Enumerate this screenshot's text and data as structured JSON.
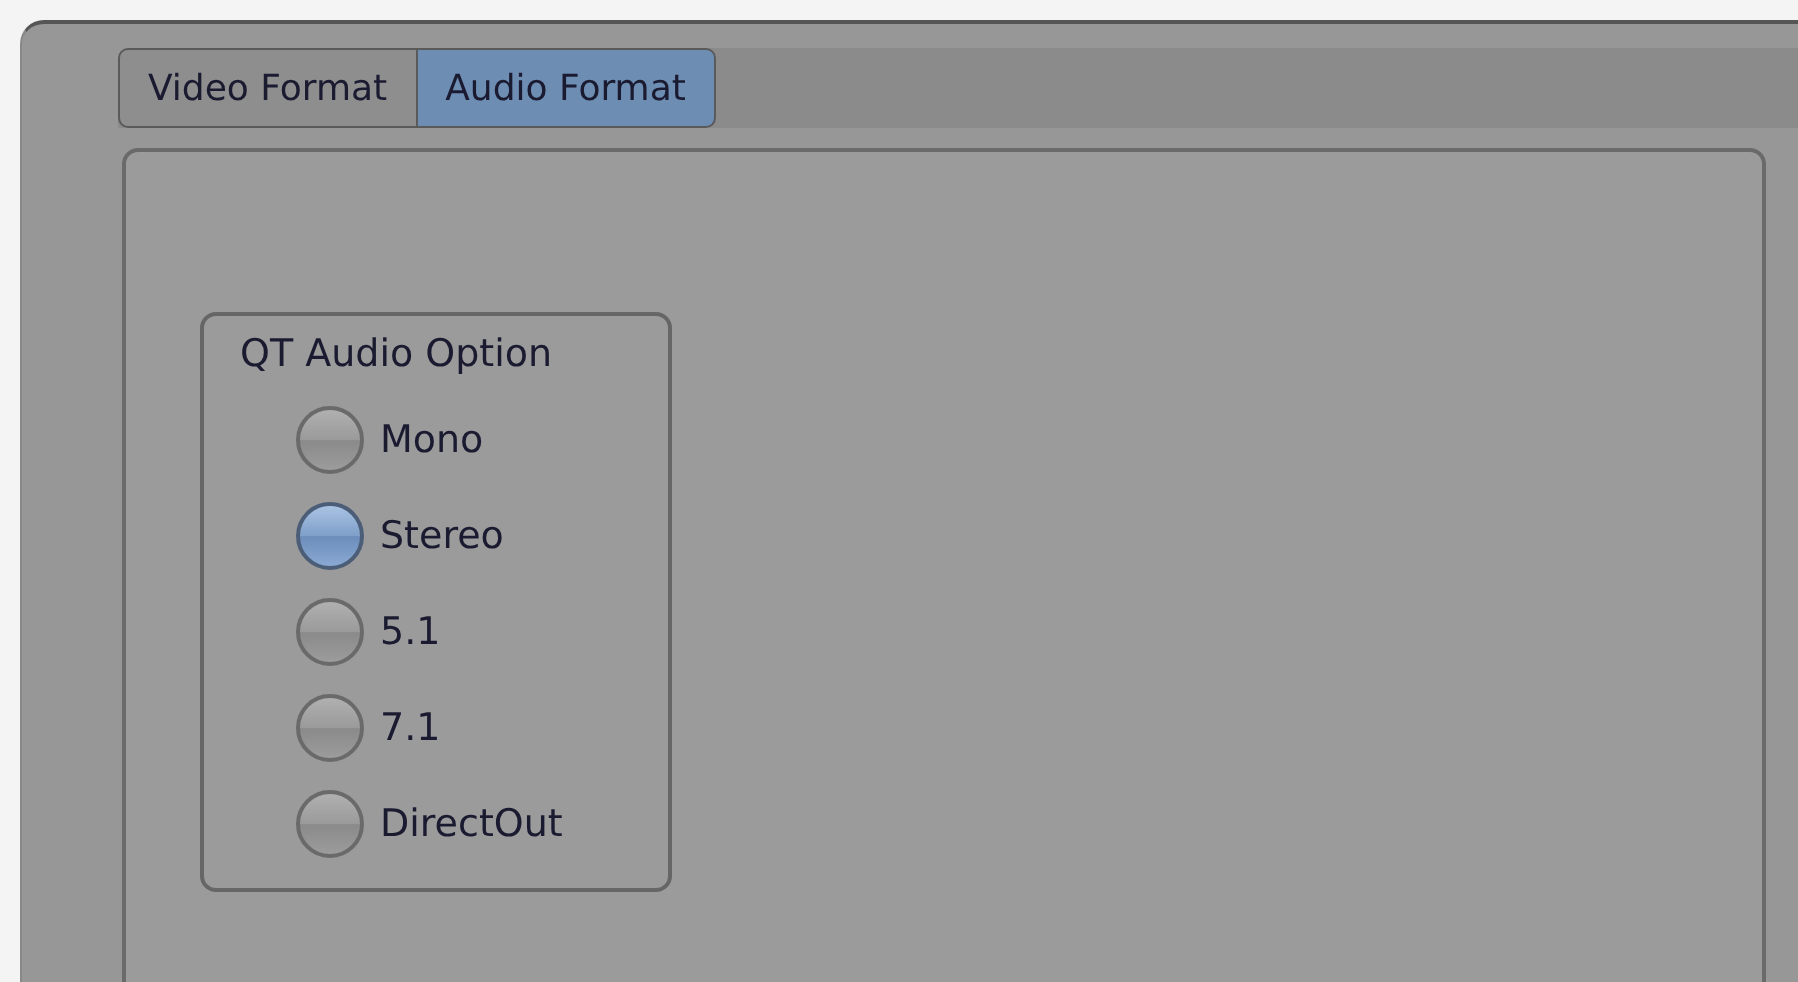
{
  "tabs": [
    {
      "label": "Video Format",
      "selected": false
    },
    {
      "label": "Audio Format",
      "selected": true
    }
  ],
  "group": {
    "title": "QT Audio Option",
    "options": [
      {
        "label": "Mono",
        "selected": false
      },
      {
        "label": "Stereo",
        "selected": true
      },
      {
        "label": "5.1",
        "selected": false
      },
      {
        "label": "7.1",
        "selected": false
      },
      {
        "label": "DirectOut",
        "selected": false
      }
    ]
  }
}
